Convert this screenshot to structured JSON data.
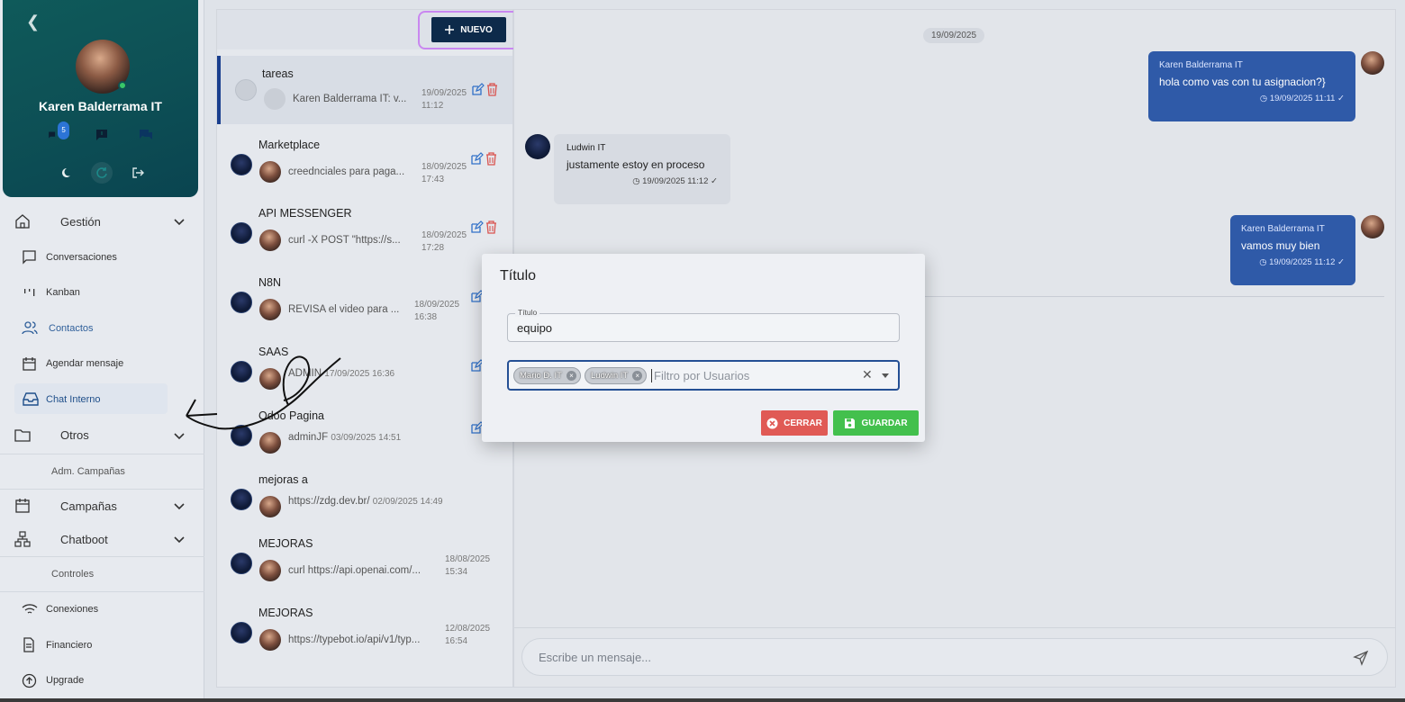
{
  "profile": {
    "name": "Karen Balderrama IT",
    "chat_badge": "5"
  },
  "menu": {
    "gestion": "Gestión",
    "conversaciones": "Conversaciones",
    "kanban": "Kanban",
    "contactos": "Contactos",
    "agendar": "Agendar mensaje",
    "chat_interno": "Chat Interno",
    "otros": "Otros",
    "adm_campanas": "Adm. Campañas",
    "campanas": "Campañas",
    "chatboot": "Chatboot",
    "controles": "Controles",
    "conexiones": "Conexiones",
    "financiero": "Financiero",
    "upgrade": "Upgrade"
  },
  "list": {
    "new_label": "NUEVO",
    "conversations": [
      {
        "title": "tareas",
        "preview": "Karen Balderrama IT: v...",
        "date": "19/09/2025",
        "time": "11:12"
      },
      {
        "title": "Marketplace",
        "preview": "creednciales para paga...",
        "date": "18/09/2025",
        "time": "17:43"
      },
      {
        "title": "API MESSENGER",
        "preview": "curl -X POST \"https://s...",
        "date": "18/09/2025",
        "time": "17:28"
      },
      {
        "title": "N8N",
        "preview": "REVISA el video para ...",
        "date": "18/09/2025",
        "time": "16:38"
      },
      {
        "title": "SAAS",
        "preview": "ADMIN",
        "date": "17/09/2025 16:36",
        "time": ""
      },
      {
        "title": "Odoo Pagina",
        "preview": "adminJF",
        "date": "03/09/2025 14:51",
        "time": ""
      },
      {
        "title": "mejoras a",
        "preview": "https://zdg.dev.br/",
        "date": "02/09/2025 14:49",
        "time": ""
      },
      {
        "title": "MEJORAS",
        "preview": "curl https://api.openai.com/...",
        "date": "18/08/2025",
        "time": "15:34"
      },
      {
        "title": "MEJORAS",
        "preview": "https://typebot.io/api/v1/typ...",
        "date": "12/08/2025",
        "time": "16:54"
      }
    ]
  },
  "chat": {
    "date_pill": "19/09/2025",
    "messages": [
      {
        "sender": "Karen Balderrama IT",
        "text": "hola como vas con tu asignacion?}",
        "time": "19/09/2025 11:11"
      },
      {
        "sender": "Ludwin IT",
        "text": "justamente estoy en proceso",
        "time": "19/09/2025 11:12"
      },
      {
        "sender": "Karen Balderrama IT",
        "text": "vamos muy bien",
        "time": "19/09/2025 11:12"
      }
    ],
    "input_placeholder": "Escribe un mensaje..."
  },
  "modal": {
    "title": "Título",
    "field_legend": "Título",
    "field_value": "equipo",
    "chips": [
      "Mario D. IT",
      "Ludwin IT"
    ],
    "filter_placeholder": "Filtro por Usuarios",
    "cerrar_label": "CERRAR",
    "guardar_label": "GUARDAR"
  },
  "colors": {
    "profile_bg": "#0f5a5a",
    "outgoing_bubble": "#2f5aa8",
    "new_button": "#0d2a4a",
    "cerrar": "#e05a55",
    "guardar": "#43c04d"
  }
}
